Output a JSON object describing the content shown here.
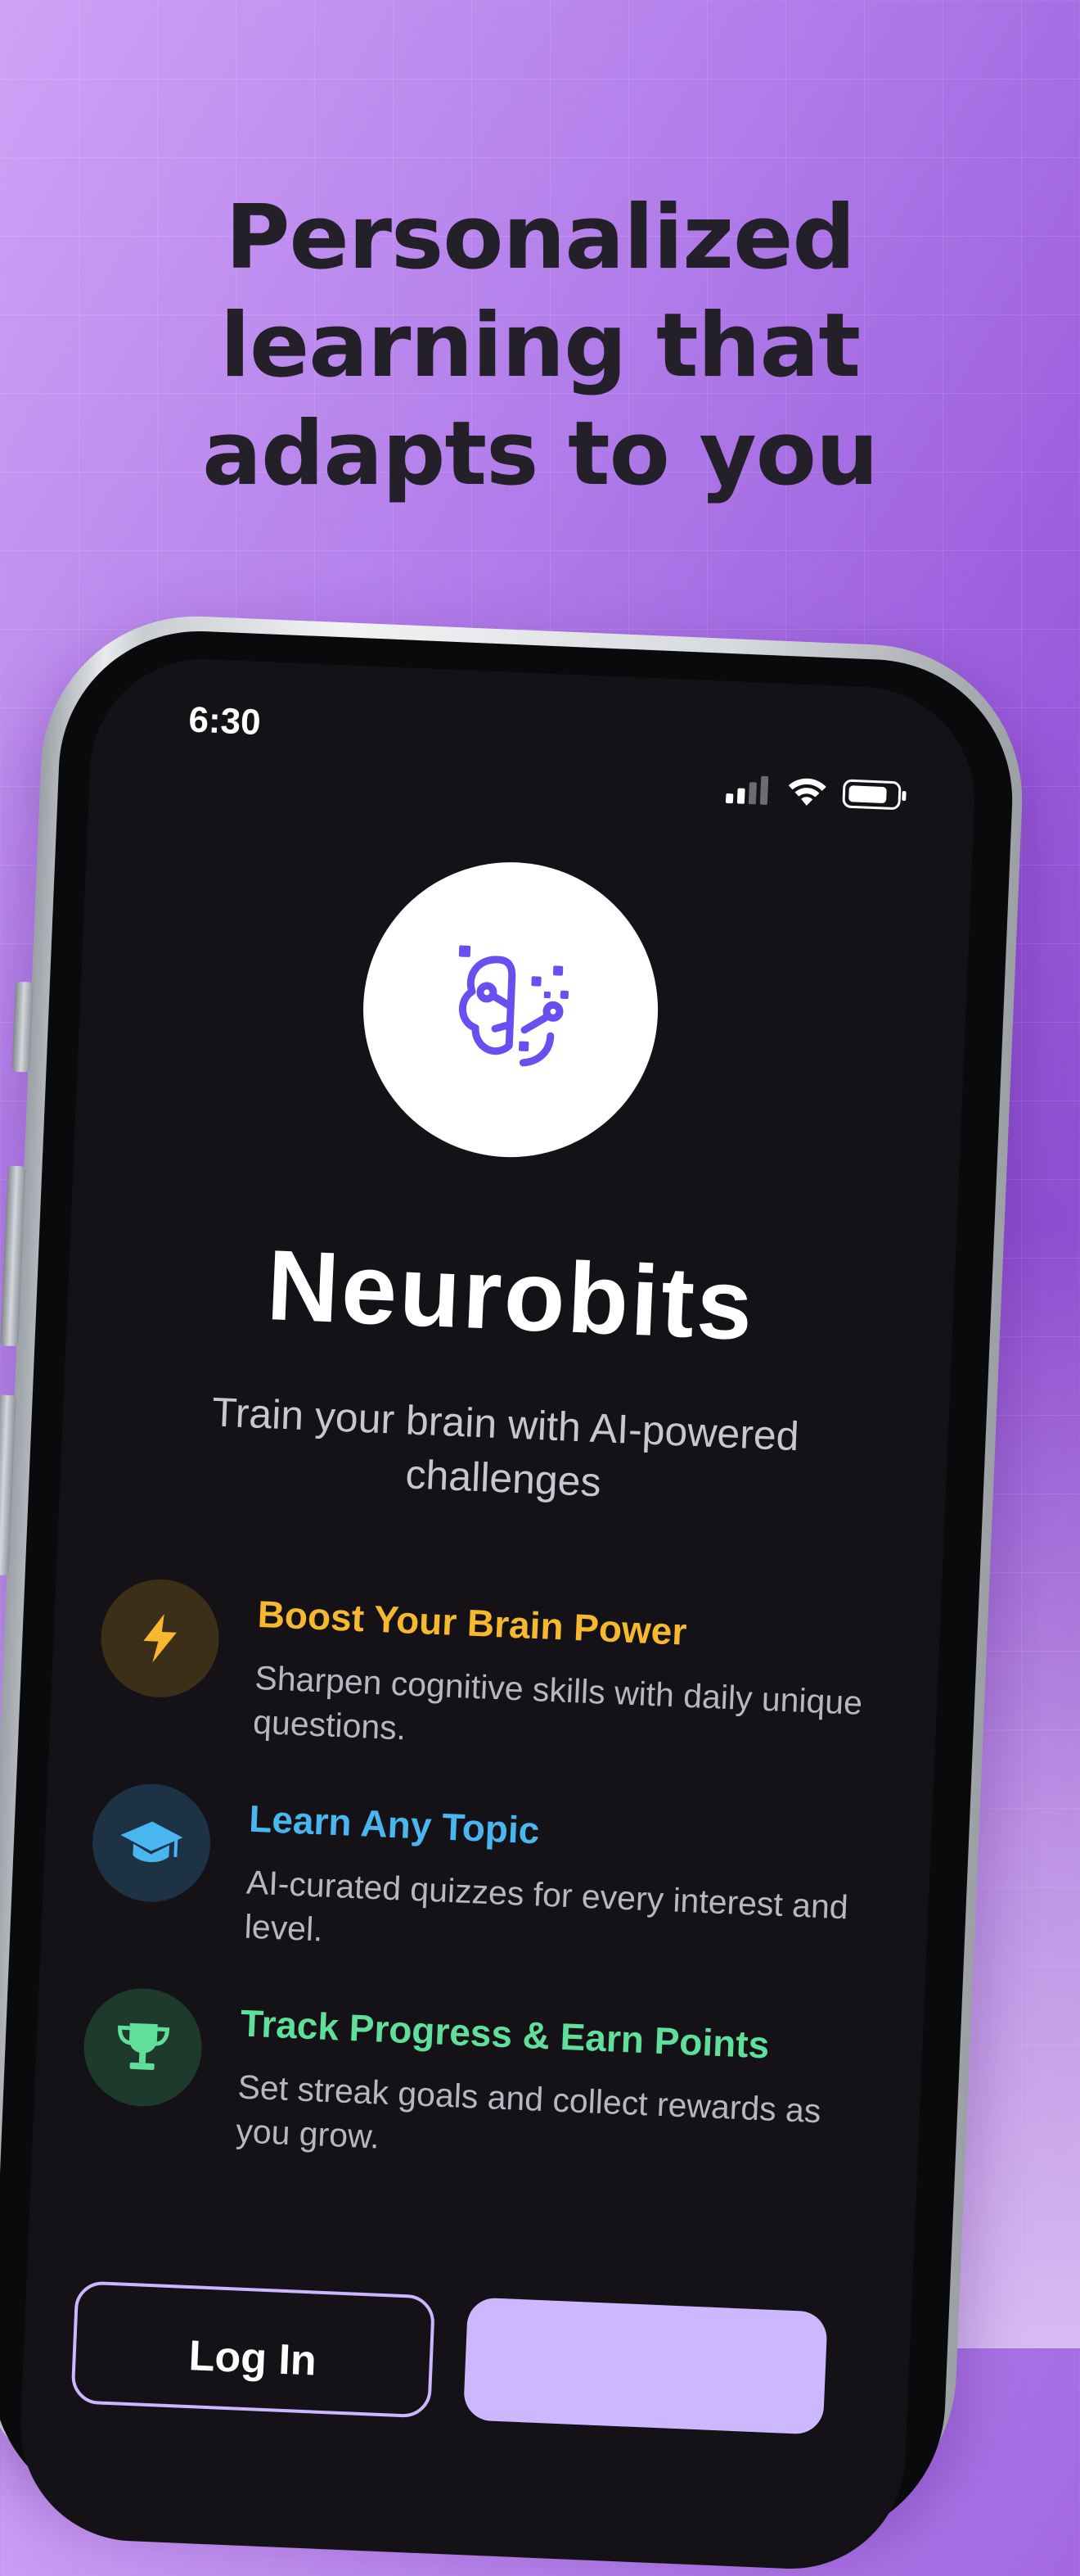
{
  "headline": {
    "line1": "Personalized",
    "line2": "learning that",
    "line3": "adapts to you"
  },
  "status_bar": {
    "time": "6:30",
    "icons": [
      "signal-icon",
      "wifi-icon",
      "battery-icon"
    ]
  },
  "app": {
    "logo_icon": "brain-circuit-icon",
    "name": "Neurobits",
    "tagline": "Train your brain with AI-powered challenges"
  },
  "features": [
    {
      "icon": "lightning-icon",
      "title": "Boost Your Brain Power",
      "description": "Sharpen cognitive skills with daily unique questions.",
      "color": "#f5b82e"
    },
    {
      "icon": "graduation-cap-icon",
      "title": "Learn Any Topic",
      "description": "AI-curated quizzes for every interest and level.",
      "color": "#49b6f0"
    },
    {
      "icon": "trophy-icon",
      "title": "Track Progress & Earn Points",
      "description": "Set streak goals and collect rewards as you grow.",
      "color": "#5fdf9a"
    }
  ],
  "buttons": {
    "login": "Log In"
  },
  "colors": {
    "background_light": "#cfa2f6",
    "background_dark": "#7d36bb",
    "screen": "#141217",
    "accent_purple": "#6a4ff0",
    "button_fill": "#cdb8ff"
  }
}
